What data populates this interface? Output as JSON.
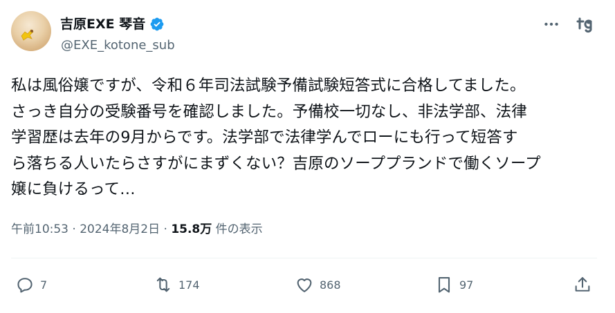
{
  "author": {
    "display_name": "吉原EXE 琴音",
    "handle": "@EXE_kotone_sub"
  },
  "tweet": {
    "text": "私は風俗嬢ですが、令和６年司法試験予備試験短答式に合格してました。\nさっき自分の受験番号を確認しました。予備校一切なし、非法学部、法律\n学習歴は去年の9月からです。法学部で法律学んでローにも行って短答す\nら落ちる人いたらさすがにまずくない？吉原のソーププランドで働くソープ\n嬢に負けるって…"
  },
  "meta": {
    "timestamp": "午前10:53 · 2024年8月2日 · ",
    "views": "15.8万",
    "views_label": " 件の表示"
  },
  "actions": {
    "reply_count": "7",
    "repost_count": "174",
    "like_count": "868",
    "bookmark_count": "97"
  },
  "icons": {
    "more": "more-icon",
    "grok": "grok-icon",
    "verified": "verified-badge-icon",
    "reply": "reply-icon",
    "repost": "repost-icon",
    "like": "like-icon",
    "bookmark": "bookmark-icon",
    "share": "share-icon"
  },
  "colors": {
    "verified": "#1d9bf0",
    "secondary_text": "#536471",
    "primary_text": "#0f1419"
  }
}
